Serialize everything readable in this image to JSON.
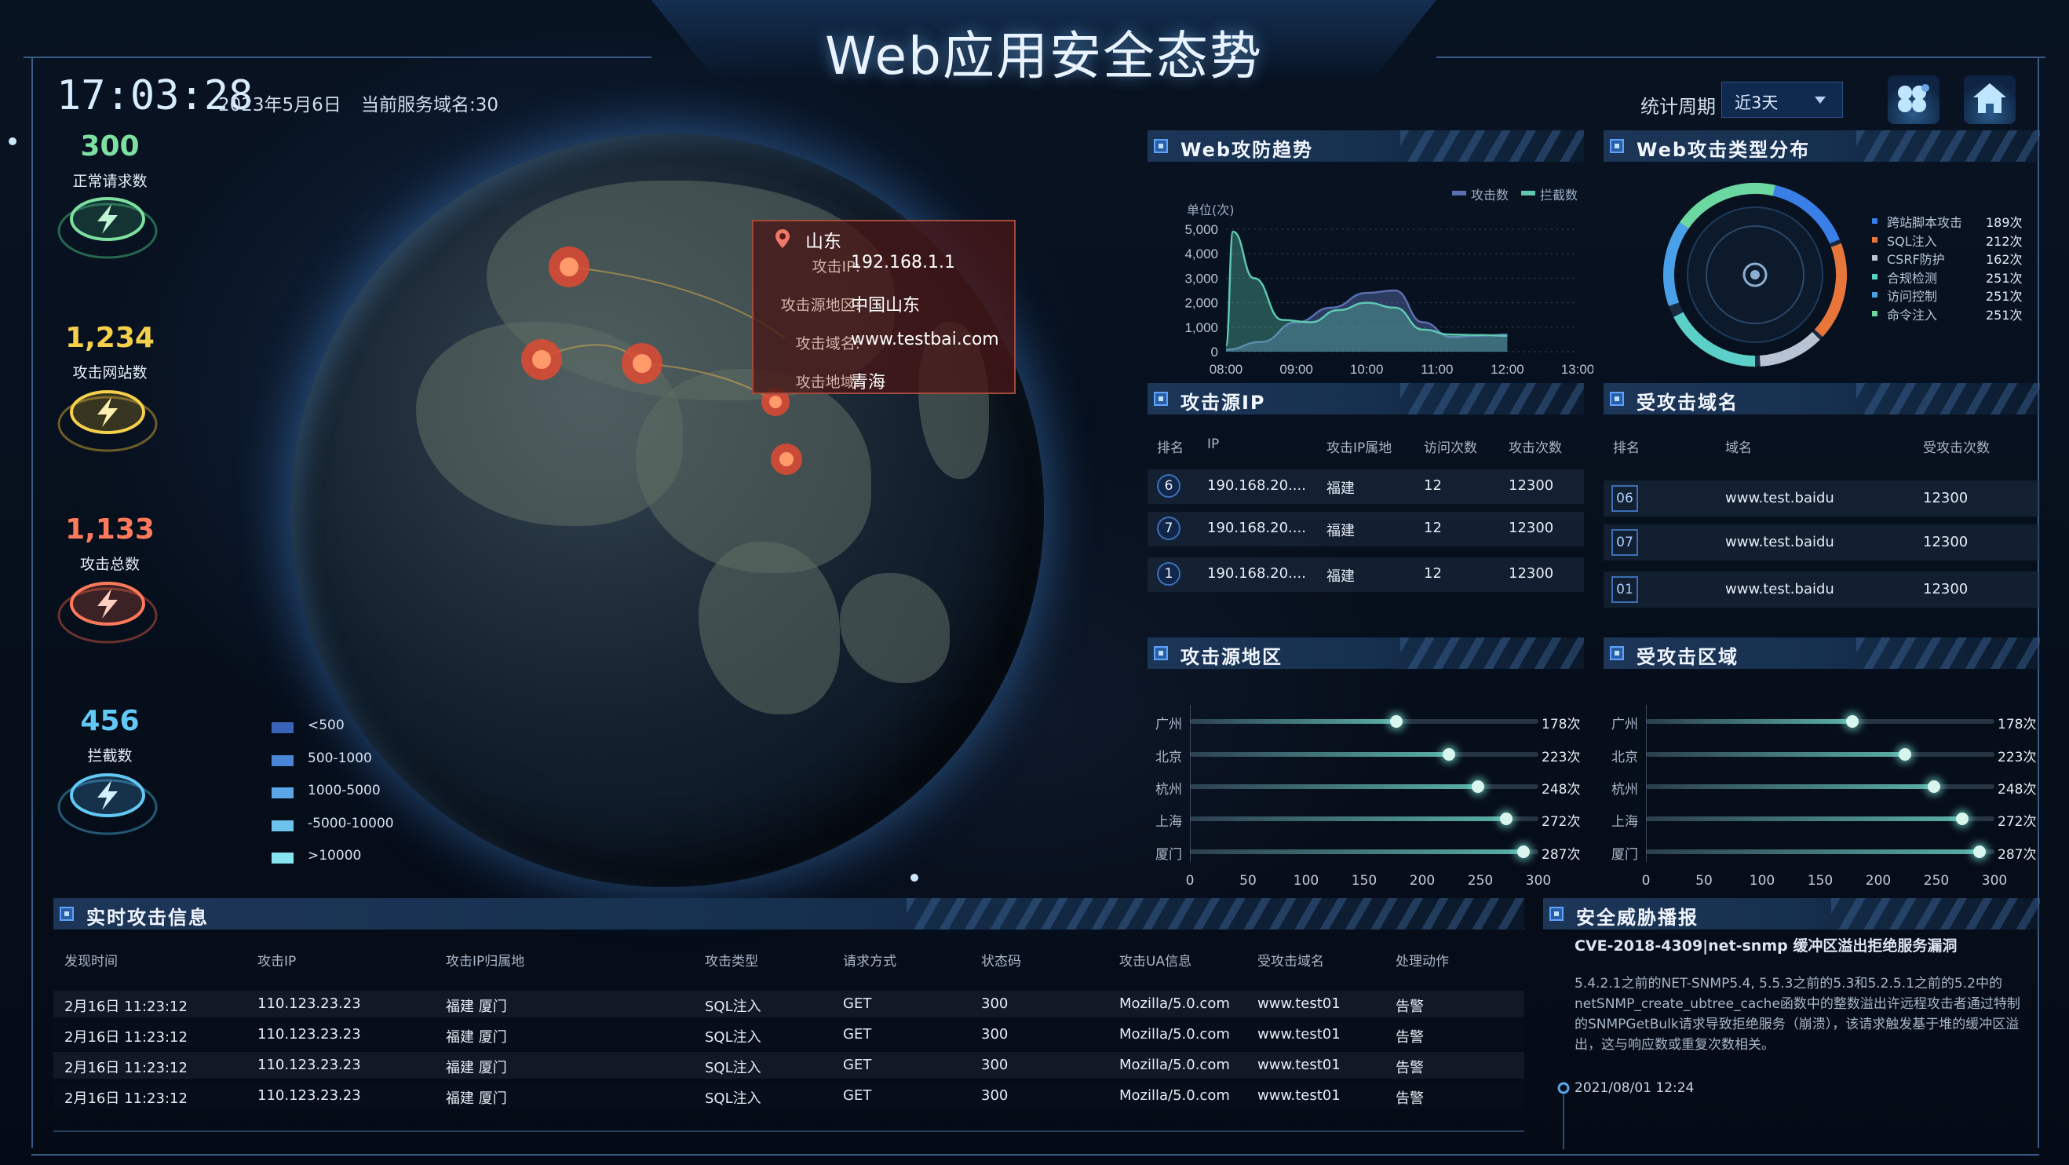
{
  "header": {
    "title": "Web应用安全态势",
    "clock": "17:03:28",
    "date": "2023年5月6日",
    "domain_count": "当前服务域名:30",
    "period_label": "统计周期",
    "period_value": "近3天"
  },
  "stats": [
    {
      "value": "300",
      "label": "正常请求数",
      "color": "#7ee0a0"
    },
    {
      "value": "1,234",
      "label": "攻击网站数",
      "color": "#f5d04a"
    },
    {
      "value": "1,133",
      "label": "攻击总数",
      "color": "#ff7a5a"
    },
    {
      "value": "456",
      "label": "拦截数",
      "color": "#62c8f5"
    }
  ],
  "legend": [
    {
      "label": "<500",
      "color": "#3a64b8"
    },
    {
      "label": "500-1000",
      "color": "#4a86d8"
    },
    {
      "label": "1000-5000",
      "color": "#5aa6e8"
    },
    {
      "label": "-5000-10000",
      "color": "#6cc4ec"
    },
    {
      "label": ">10000",
      "color": "#86e4f0"
    }
  ],
  "tooltip": {
    "region": "山东",
    "rows": [
      {
        "key": "攻击IP:",
        "value": "192.168.1.1"
      },
      {
        "key": "攻击源地区:",
        "value": "中国山东"
      },
      {
        "key": "攻击域名:",
        "value": "www.testbai.com"
      },
      {
        "key": "攻击地域:",
        "value": "青海"
      }
    ]
  },
  "trend": {
    "title": "Web攻防趋势",
    "unit": "单位(次)",
    "legend": [
      "攻击数",
      "拦截数"
    ],
    "chart_data": {
      "type": "area",
      "categories": [
        "08:00",
        "09:00",
        "10:00",
        "11:00",
        "12:00",
        "13:00"
      ],
      "y_ticks": [
        "5,000",
        "4,000",
        "3,000",
        "2,000",
        "1,000",
        "0"
      ],
      "ylim": [
        0,
        5000
      ],
      "series": [
        {
          "name": "攻击数",
          "color": "#5b6fb0",
          "x": [
            8.0,
            8.5,
            9.0,
            9.5,
            10.0,
            10.4,
            10.8,
            11.2,
            11.6,
            12.0
          ],
          "values": [
            80,
            400,
            1200,
            1800,
            2400,
            2500,
            1200,
            600,
            650,
            700
          ]
        },
        {
          "name": "拦截数",
          "color": "#5ec8b0",
          "x": [
            8.0,
            8.1,
            8.4,
            8.8,
            9.2,
            9.6,
            10.0,
            10.4,
            10.8,
            11.2,
            11.6,
            12.0
          ],
          "values": [
            250,
            4900,
            3000,
            1300,
            1200,
            1700,
            2000,
            1800,
            900,
            700,
            680,
            650
          ]
        }
      ]
    }
  },
  "attack_types": {
    "title": "Web攻击类型分布",
    "items": [
      {
        "label": "跨站脚本攻击",
        "value": "189次",
        "color": "#3a7ee8"
      },
      {
        "label": "SQL注入",
        "value": "212次",
        "color": "#e8763a"
      },
      {
        "label": "CSRF防护",
        "value": "162次",
        "color": "#b8c4d4"
      },
      {
        "label": "合规检测",
        "value": "251次",
        "color": "#5ad0c8"
      },
      {
        "label": "访问控制",
        "value": "251次",
        "color": "#4aa0e8"
      },
      {
        "label": "命令注入",
        "value": "251次",
        "color": "#6ad8a0"
      }
    ]
  },
  "source_ip": {
    "title": "攻击源IP",
    "headers": [
      "排名",
      "IP",
      "攻击IP属地",
      "访问次数",
      "攻击次数"
    ],
    "rows": [
      {
        "rank": "6",
        "ip": "190.168.20....",
        "loc": "福建",
        "visits": "12",
        "attacks": "12300"
      },
      {
        "rank": "7",
        "ip": "190.168.20....",
        "loc": "福建",
        "visits": "12",
        "attacks": "12300"
      },
      {
        "rank": "1",
        "ip": "190.168.20....",
        "loc": "福建",
        "visits": "12",
        "attacks": "12300"
      }
    ]
  },
  "target_domain": {
    "title": "受攻击域名",
    "headers": [
      "排名",
      "域名",
      "受攻击次数"
    ],
    "rows": [
      {
        "rank": "06",
        "domain": "www.test.baidu",
        "count": "12300"
      },
      {
        "rank": "07",
        "domain": "www.test.baidu",
        "count": "12300"
      },
      {
        "rank": "01",
        "domain": "www.test.baidu",
        "count": "12300"
      }
    ]
  },
  "source_region": {
    "title": "攻击源地区",
    "chart_data": {
      "type": "bar",
      "categories": [
        "广州",
        "北京",
        "杭州",
        "上海",
        "厦门"
      ],
      "values": [
        178,
        223,
        248,
        272,
        287
      ],
      "labels": [
        "178次",
        "223次",
        "248次",
        "272次",
        "287次"
      ],
      "ticks": [
        "0",
        "50",
        "100",
        "150",
        "200",
        "250",
        "300"
      ],
      "xlim": [
        0,
        300
      ]
    }
  },
  "target_region": {
    "title": "受攻击区域",
    "chart_data": {
      "type": "bar",
      "categories": [
        "广州",
        "北京",
        "杭州",
        "上海",
        "厦门"
      ],
      "values": [
        178,
        223,
        248,
        272,
        287
      ],
      "labels": [
        "178次",
        "223次",
        "248次",
        "272次",
        "287次"
      ],
      "ticks": [
        "0",
        "50",
        "100",
        "150",
        "200",
        "250",
        "300"
      ],
      "xlim": [
        0,
        300
      ]
    }
  },
  "realtime": {
    "title": "实时攻击信息",
    "headers": [
      "发现时间",
      "攻击IP",
      "攻击IP归属地",
      "攻击类型",
      "请求方式",
      "状态码",
      "攻击UA信息",
      "受攻击域名",
      "处理动作"
    ],
    "rows": [
      [
        "2月16日 11:23:12",
        "110.123.23.23",
        "福建 厦门",
        "SQL注入",
        "GET",
        "300",
        "Mozilla/5.0.com",
        "www.test01",
        "告警"
      ],
      [
        "2月16日 11:23:12",
        "110.123.23.23",
        "福建 厦门",
        "SQL注入",
        "GET",
        "300",
        "Mozilla/5.0.com",
        "www.test01",
        "告警"
      ],
      [
        "2月16日 11:23:12",
        "110.123.23.23",
        "福建 厦门",
        "SQL注入",
        "GET",
        "300",
        "Mozilla/5.0.com",
        "www.test01",
        "告警"
      ],
      [
        "2月16日 11:23:12",
        "110.123.23.23",
        "福建 厦门",
        "SQL注入",
        "GET",
        "300",
        "Mozilla/5.0.com",
        "www.test01",
        "告警"
      ]
    ]
  },
  "threat": {
    "title": "安全威胁播报",
    "headline": "CVE-2018-4309|net-snmp 缓冲区溢出拒绝服务漏洞",
    "body": "5.4.2.1之前的NET-SNMP5.4, 5.5.3之前的5.3和5.2.5.1之前的5.2中的netSNMP_create_ubtree_cache函数中的整数溢出许远程攻击者通过特制的SNMPGetBulk请求导致拒绝服务（崩溃），该请求触发基于堆的缓冲区溢出，这与响应数或重复次数相关。",
    "time": "2021/08/01 12:24"
  }
}
